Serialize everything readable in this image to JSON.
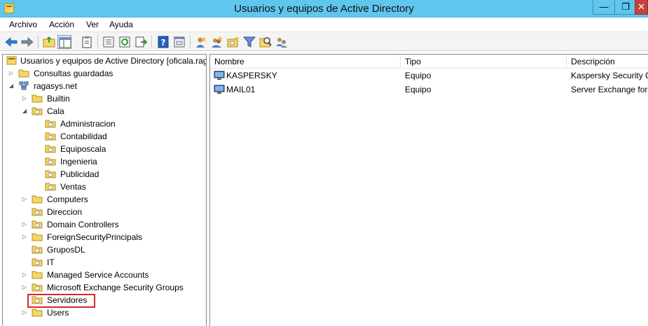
{
  "window": {
    "title": "Usuarios y equipos de Active Directory"
  },
  "menu": [
    "Archivo",
    "Acción",
    "Ver",
    "Ayuda"
  ],
  "toolbar_icons": [
    "back-arrow-icon",
    "forward-arrow-icon",
    "up-folder-icon",
    "show-console-tree-icon",
    "clipboard-icon",
    "properties-icon",
    "refresh-icon",
    "export-list-icon",
    "help-icon",
    "console-icon",
    "new-user-icon",
    "new-group-icon",
    "new-ou-icon",
    "filter-icon",
    "find-icon",
    "add-to-group-icon"
  ],
  "tree": {
    "root": "Usuarios y equipos de Active Directory [oficala.rag",
    "items": [
      {
        "label": "Consultas guardadas"
      },
      {
        "label": "ragasys.net"
      },
      {
        "label": "Builtin"
      },
      {
        "label": "Cala"
      },
      {
        "label": "Administracion"
      },
      {
        "label": "Contabilidad"
      },
      {
        "label": "Equiposcala"
      },
      {
        "label": "Ingenieria"
      },
      {
        "label": "Publicidad"
      },
      {
        "label": "Ventas"
      },
      {
        "label": "Computers"
      },
      {
        "label": "Direccion"
      },
      {
        "label": "Domain Controllers"
      },
      {
        "label": "ForeignSecurityPrincipals"
      },
      {
        "label": "GruposDL"
      },
      {
        "label": "IT"
      },
      {
        "label": "Managed Service Accounts"
      },
      {
        "label": "Microsoft Exchange Security Groups"
      },
      {
        "label": "Servidores"
      },
      {
        "label": "Users"
      }
    ]
  },
  "list": {
    "columns": [
      "Nombre",
      "Tipo",
      "Descripción"
    ],
    "rows": [
      {
        "name": "KASPERSKY",
        "type": "Equipo",
        "description": "Kaspersky Security Ce"
      },
      {
        "name": "MAIL01",
        "type": "Equipo",
        "description": "Server Exchange for r"
      }
    ]
  },
  "colors": {
    "titlebar": "#5fc6ee",
    "highlight": "#d42a2a",
    "folder": "#f4d768"
  }
}
